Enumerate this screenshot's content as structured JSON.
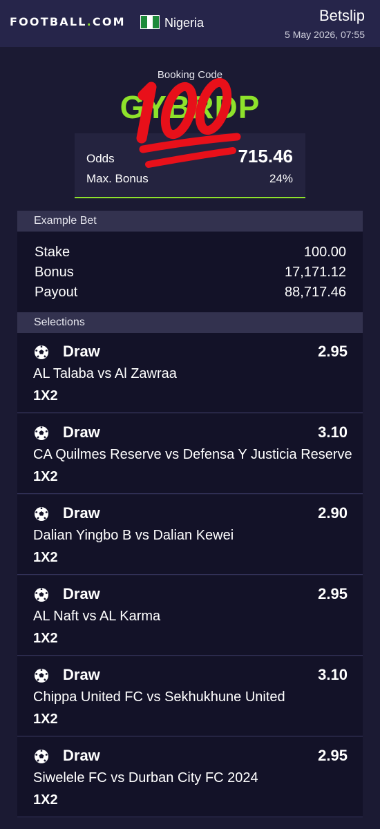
{
  "header": {
    "brand_name": "FOOTBALL",
    "brand_dot": ".",
    "brand_tld": "COM",
    "country": "Nigeria",
    "title": "Betslip",
    "datetime": "5 May 2026, 07:55",
    "flag_colors": [
      "#1d8a3a",
      "#ffffff",
      "#1d8a3a"
    ]
  },
  "booking": {
    "label": "Booking Code",
    "code": "GYBRDP",
    "odds_label": "Odds",
    "odds_value": "715.46",
    "bonus_label": "Max. Bonus",
    "bonus_value": "24%",
    "overlay_icon": "hundred-points-emoji"
  },
  "example_bet": {
    "heading": "Example Bet",
    "rows": [
      {
        "label": "Stake",
        "value": "100.00"
      },
      {
        "label": "Bonus",
        "value": "17,171.12"
      },
      {
        "label": "Payout",
        "value": "88,717.46"
      }
    ]
  },
  "selections": {
    "heading": "Selections",
    "icon": "soccer-ball-icon",
    "items": [
      {
        "pick": "Draw",
        "odds": "2.95",
        "match": "AL Talaba vs Al Zawraa",
        "market": "1X2"
      },
      {
        "pick": "Draw",
        "odds": "3.10",
        "match": "CA Quilmes Reserve vs Defensa Y Justicia Reserve",
        "market": "1X2"
      },
      {
        "pick": "Draw",
        "odds": "2.90",
        "match": "Dalian Yingbo B vs Dalian Kewei",
        "market": "1X2"
      },
      {
        "pick": "Draw",
        "odds": "2.95",
        "match": "AL Naft vs AL Karma",
        "market": "1X2"
      },
      {
        "pick": "Draw",
        "odds": "3.10",
        "match": "Chippa United FC vs Sekhukhune United",
        "market": "1X2"
      },
      {
        "pick": "Draw",
        "odds": "2.95",
        "match": "Siwelele FC vs Durban City FC 2024",
        "market": "1X2"
      }
    ]
  },
  "colors": {
    "background": "#1b1a33",
    "header": "#26254a",
    "accent_green": "#8ee22b",
    "card": "#131228",
    "section_head": "#33324f"
  }
}
